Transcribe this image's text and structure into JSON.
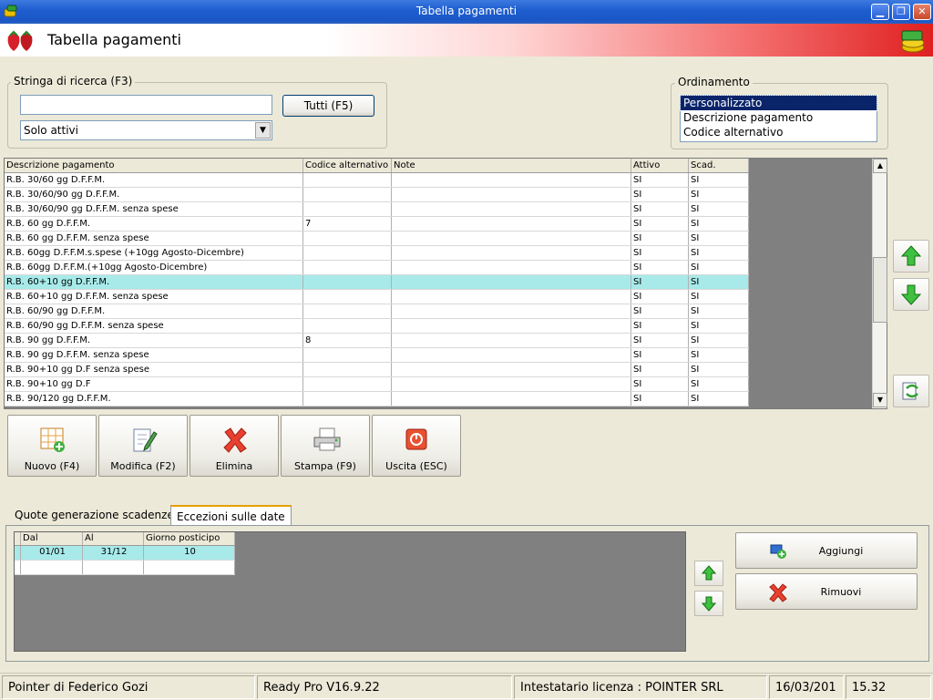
{
  "window": {
    "title": "Tabella pagamenti"
  },
  "header": {
    "title": "Tabella pagamenti"
  },
  "search": {
    "legend": "Stringa di ricerca (F3)",
    "value": "",
    "all_button": "Tutti (F5)",
    "filter_selected": "Solo attivi"
  },
  "sorting": {
    "legend": "Ordinamento",
    "options": [
      "Personalizzato",
      "Descrizione pagamento",
      "Codice alternativo"
    ],
    "selected_index": 0
  },
  "grid": {
    "columns": [
      "Descrizione pagamento",
      "Codice alternativo",
      "Note",
      "Attivo",
      "Scad."
    ],
    "rows": [
      [
        "R.B.  30/60 gg D.F.F.M.",
        "",
        "",
        "SI",
        "SI"
      ],
      [
        "R.B.  30/60/90 gg D.F.F.M.",
        "",
        "",
        "SI",
        "SI"
      ],
      [
        "R.B.  30/60/90 gg D.F.F.M. senza spese",
        "",
        "",
        "SI",
        "SI"
      ],
      [
        "R.B.  60 gg D.F.F.M.",
        "7",
        "",
        "SI",
        "SI"
      ],
      [
        "R.B.  60 gg D.F.F.M. senza spese",
        "",
        "",
        "SI",
        "SI"
      ],
      [
        "R.B.  60gg D.F.F.M.s.spese (+10gg Agosto-Dicembre)",
        "",
        "",
        "SI",
        "SI"
      ],
      [
        "R.B.  60gg D.F.F.M.(+10gg Agosto-Dicembre)",
        "",
        "",
        "SI",
        "SI"
      ],
      [
        "R.B.  60+10 gg D.F.F.M.",
        "",
        "",
        "SI",
        "SI"
      ],
      [
        "R.B.  60+10 gg D.F.F.M. senza spese",
        "",
        "",
        "SI",
        "SI"
      ],
      [
        "R.B.  60/90 gg D.F.F.M.",
        "",
        "",
        "SI",
        "SI"
      ],
      [
        "R.B.  60/90 gg D.F.F.M. senza spese",
        "",
        "",
        "SI",
        "SI"
      ],
      [
        "R.B.  90 gg D.F.F.M.",
        "8",
        "",
        "SI",
        "SI"
      ],
      [
        "R.B.  90 gg D.F.F.M. senza spese",
        "",
        "",
        "SI",
        "SI"
      ],
      [
        "R.B.  90+10 gg D.F senza spese",
        "",
        "",
        "SI",
        "SI"
      ],
      [
        "R.B.  90+10 gg D.F",
        "",
        "",
        "SI",
        "SI"
      ],
      [
        "R.B.  90/120 gg D.F.F.M.",
        "",
        "",
        "SI",
        "SI"
      ]
    ],
    "selected_row": 7
  },
  "toolbar": {
    "new": "Nuovo (F4)",
    "edit": "Modifica (F2)",
    "delete": "Elimina",
    "print": "Stampa (F9)",
    "exit": "Uscita (ESC)"
  },
  "tabs": [
    "Quote generazione scadenze",
    "Eccezioni sulle date"
  ],
  "active_tab": 1,
  "exceptions": {
    "columns": [
      "Dal",
      "Al",
      "Giorno posticipo"
    ],
    "rows": [
      [
        "01/01",
        "31/12",
        "10"
      ]
    ]
  },
  "actions": {
    "add": "Aggiungi",
    "remove": "Rimuovi"
  },
  "status": {
    "company": "Pointer di Federico Gozi",
    "version": "Ready Pro V16.9.22",
    "license": "Intestatario licenza : POINTER SRL",
    "date": "16/03/201",
    "time": "15.32"
  },
  "colors": {
    "title_blue": "#1f5fd0",
    "selection_cyan": "#a8eaea",
    "header_red": "#e02020"
  },
  "icons": [
    "app-icon",
    "strawberry-icon",
    "coins-icon",
    "arrow-up-icon",
    "arrow-down-icon",
    "refresh-icon",
    "new-grid-icon",
    "edit-icon",
    "delete-x-icon",
    "printer-icon",
    "power-icon",
    "add-icon",
    "remove-x-icon"
  ]
}
